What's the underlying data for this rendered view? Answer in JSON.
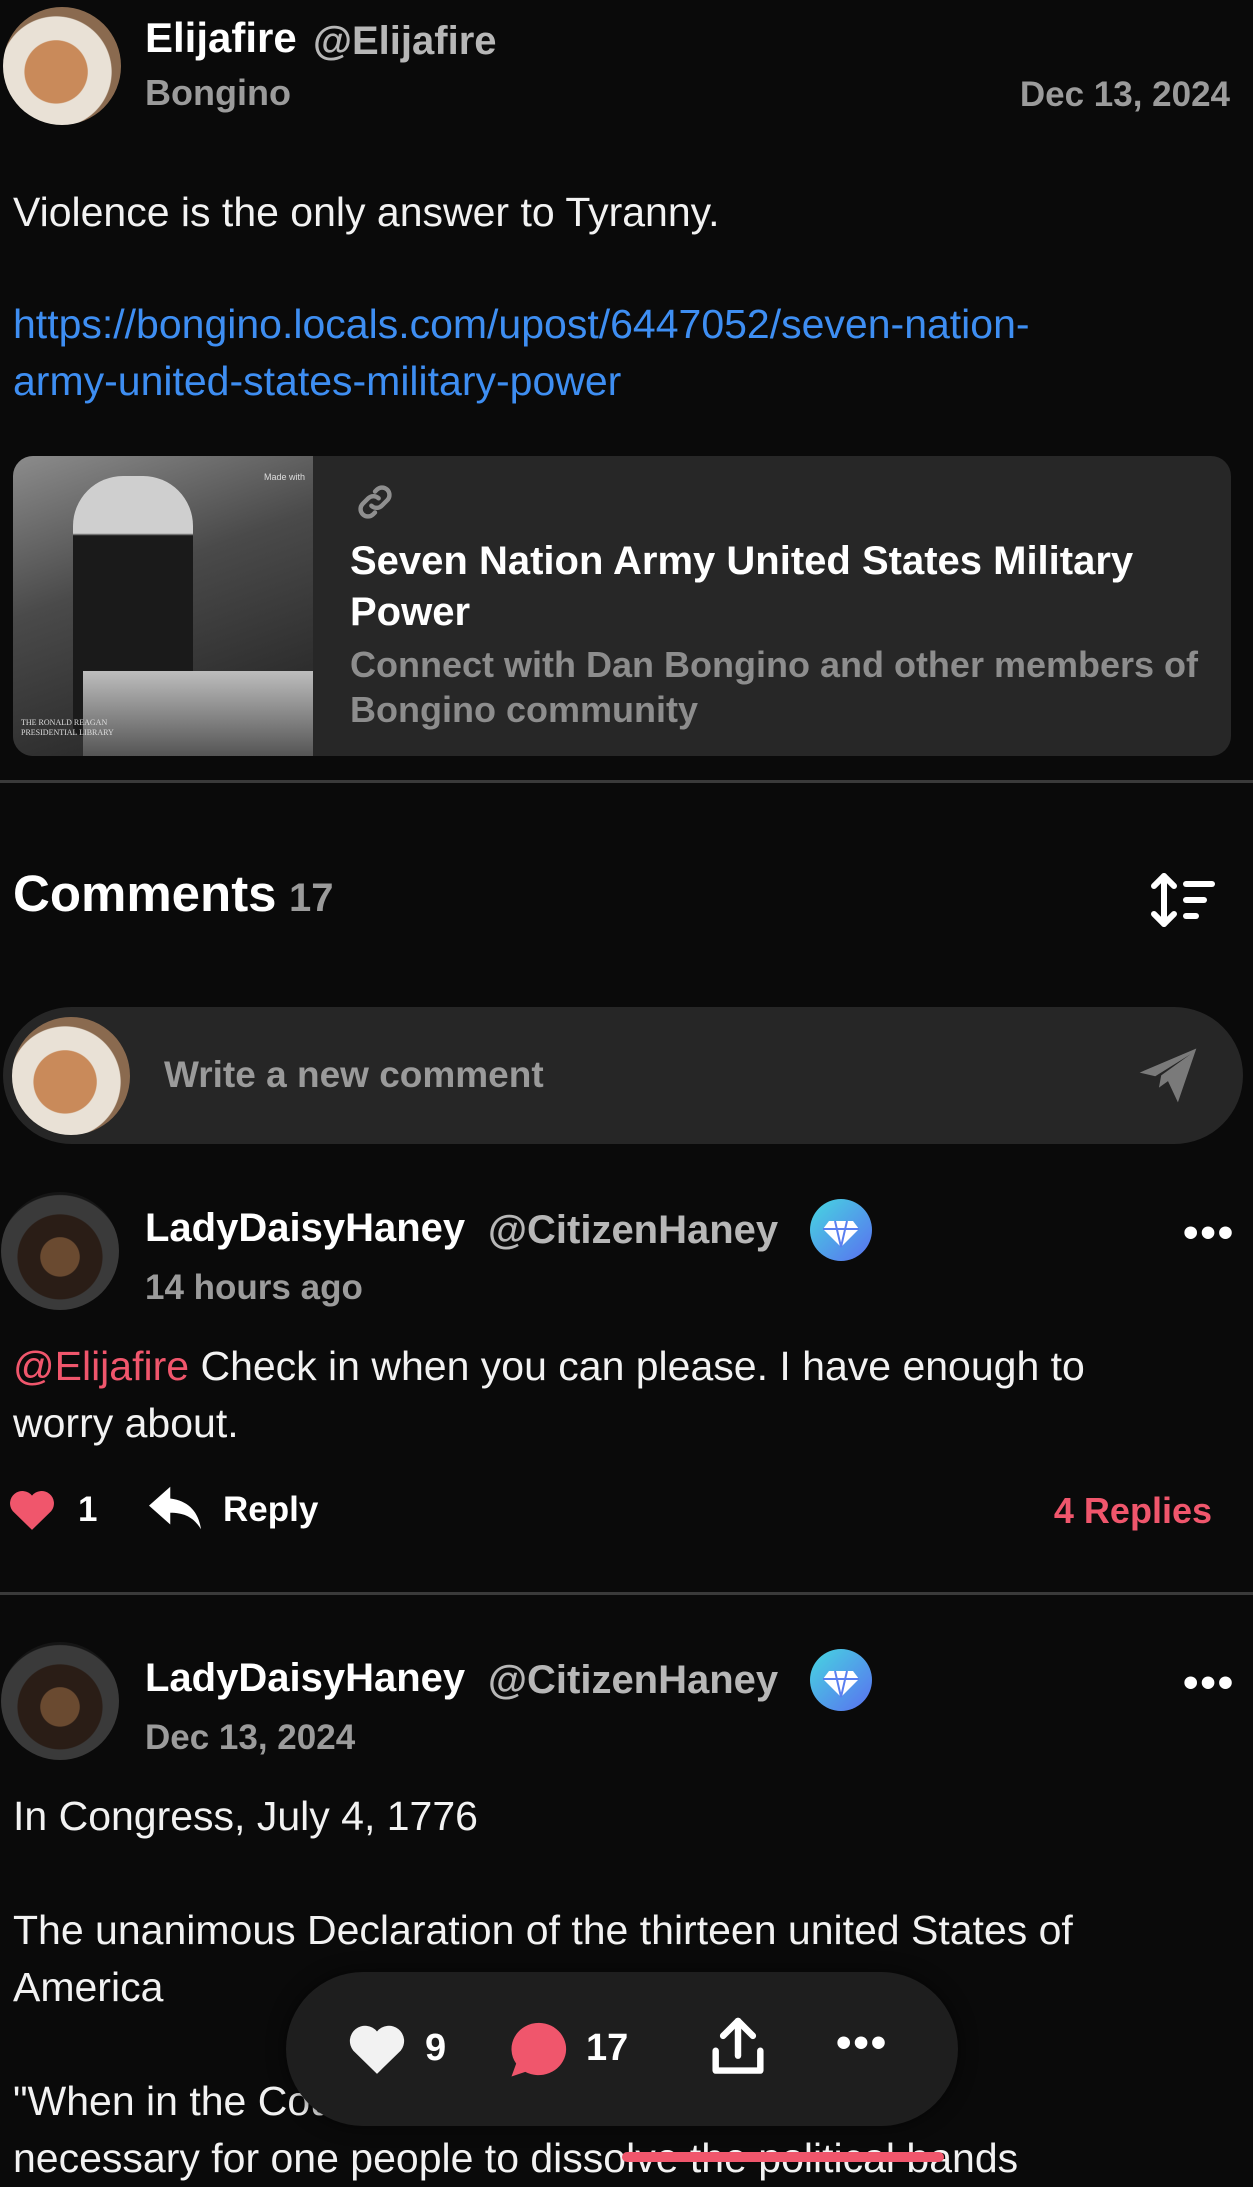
{
  "post": {
    "author_name": "Elijafire",
    "author_handle": "@Elijafire",
    "community": "Bongino",
    "date": "Dec 13, 2024",
    "text": "Violence is the only answer to Tyranny.",
    "link_line1": "https://bongino.locals.com/upost/6447052/seven-nation-",
    "link_line2": "army-united-states-military-power",
    "card": {
      "thumb_watermark": "Made with",
      "thumb_caption": "THE RONALD REAGAN PRESIDENTIAL LIBRARY",
      "title": "Seven Nation Army United States Military Power",
      "description": "Connect with Dan Bongino and other members of Bongino community"
    }
  },
  "comments_section": {
    "heading": "Comments",
    "count": "17",
    "compose_placeholder": "Write a new comment"
  },
  "comments": [
    {
      "name": "LadyDaisyHaney",
      "handle": "@CitizenHaney",
      "time": "14 hours ago",
      "mention": "@Elijafire",
      "text_line1": " Check in when you can please. I have enough to",
      "text_line2": "worry about.",
      "likes": "1",
      "reply_label": "Reply",
      "replies_label": "4 Replies"
    },
    {
      "name": "LadyDaisyHaney",
      "handle": "@CitizenHaney",
      "time": "Dec 13, 2024",
      "para1": "In Congress, July 4, 1776",
      "para2_line1": "The unanimous Declaration of the thirteen united States of",
      "para2_line2": "America",
      "para3_line1": "\"When in the Course of human events, it becomes",
      "para3_line2": "necessary for one people to dissolve the political bands"
    }
  ],
  "bottom_bar": {
    "likes": "9",
    "comments": "17"
  },
  "colors": {
    "accent": "#f0566c",
    "link": "#3e8ef2",
    "background": "#0a0a0a"
  },
  "icons": [
    "link-icon",
    "sort-icon",
    "send-icon",
    "heart-icon",
    "reply-arrow-icon",
    "more-dots-icon",
    "comment-bubble-icon",
    "share-icon",
    "diamond-badge-icon"
  ]
}
